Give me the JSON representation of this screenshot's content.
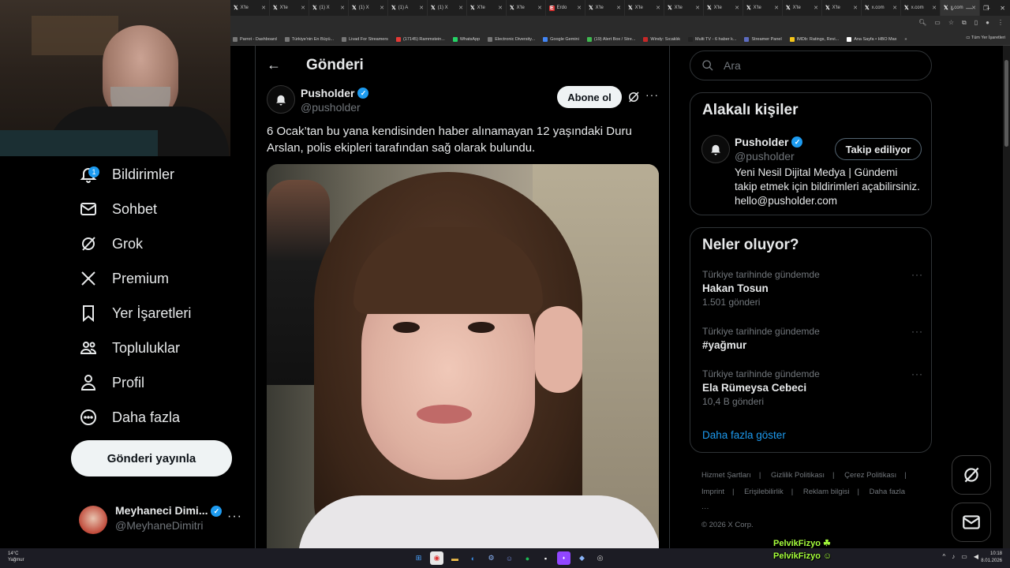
{
  "tabs": [
    "X'te",
    "X'te",
    "(1) X",
    "(1) X",
    "(1) A",
    "(1) X",
    "X'te",
    "X'te",
    "Erdo",
    "X'te",
    "X'te",
    "X'te",
    "X'te",
    "X'te",
    "X'te",
    "X'te",
    "x.com",
    "x.com",
    "x.com"
  ],
  "bookmarks": [
    "Parrot - Dashboard",
    "Türkiye'nin En Büyü...",
    "Livad For Streamers",
    "(17145) Rammstein...",
    "WhatsApp",
    "Electronic Diversity...",
    "Google Gemini",
    "(19) Alert Box / Stre...",
    "Windy: Sıcaklık",
    "Multi TV - 6 haber k...",
    "Streamer Panel",
    "IMDb: Ratings, Revi...",
    "Ana Sayfa • HBO Max"
  ],
  "bookmarks_folder": "Tüm Yer İşaretleri",
  "nav": {
    "notifications": "Bildirimler",
    "notifications_badge": "1",
    "messages": "Sohbet",
    "grok": "Grok",
    "premium": "Premium",
    "bookmarks": "Yer İşaretleri",
    "communities": "Topluluklar",
    "profile": "Profil",
    "more": "Daha fazla",
    "post_button": "Gönderi yayınla"
  },
  "account": {
    "name": "Meyhaneci Dimi...",
    "handle": "@MeyhaneDimitri",
    "more": "···"
  },
  "post": {
    "header_title": "Gönderi",
    "author_name": "Pusholder",
    "author_handle": "@pusholder",
    "subscribe_label": "Abone ol",
    "more": "···",
    "text": "6 Ocak’tan bu yana kendisinden haber alınamayan 12 yaşındaki Duru Arslan, polis ekipleri tarafından sağ olarak bulundu."
  },
  "search": {
    "placeholder": "Ara"
  },
  "related": {
    "title": "Alakalı kişiler",
    "name": "Pusholder",
    "handle": "@pusholder",
    "follow_label": "Takip ediliyor",
    "bio": "Yeni Nesil Dijital Medya | Gündemi takip etmek için bildirimleri açabilirsiniz. hello@pusholder.com"
  },
  "trends": {
    "title": "Neler oluyor?",
    "items": [
      {
        "context": "Türkiye tarihinde gündemde",
        "topic": "Hakan Tosun",
        "count": "1.501 gönderi"
      },
      {
        "context": "Türkiye tarihinde gündemde",
        "topic": "#yağmur",
        "count": ""
      },
      {
        "context": "Türkiye tarihinde gündemde",
        "topic": "Ela Rümeysa Cebeci",
        "count": "10,4 B gönderi"
      }
    ],
    "show_more": "Daha fazla göster"
  },
  "footer": {
    "terms": "Hizmet Şartları",
    "privacy": "Gizlilik Politikası",
    "cookies": "Çerez Politikası",
    "imprint": "Imprint",
    "accessibility": "Erişilebilirlik",
    "ads": "Reklam bilgisi",
    "more": "Daha fazla ···",
    "copyright": "© 2026 X Corp."
  },
  "overlay": {
    "line1": "PelvikFizyo",
    "line2": "PelvikFizyo"
  },
  "taskbar": {
    "temp": "14°C",
    "weather": "Yağmur",
    "time": "10:18",
    "date": "8.01.2026"
  },
  "colors": {
    "accent": "#1d9bf0",
    "background": "#000000",
    "text": "#e7e9ea",
    "muted": "#71767b",
    "overlay": "#a6ff3c"
  }
}
